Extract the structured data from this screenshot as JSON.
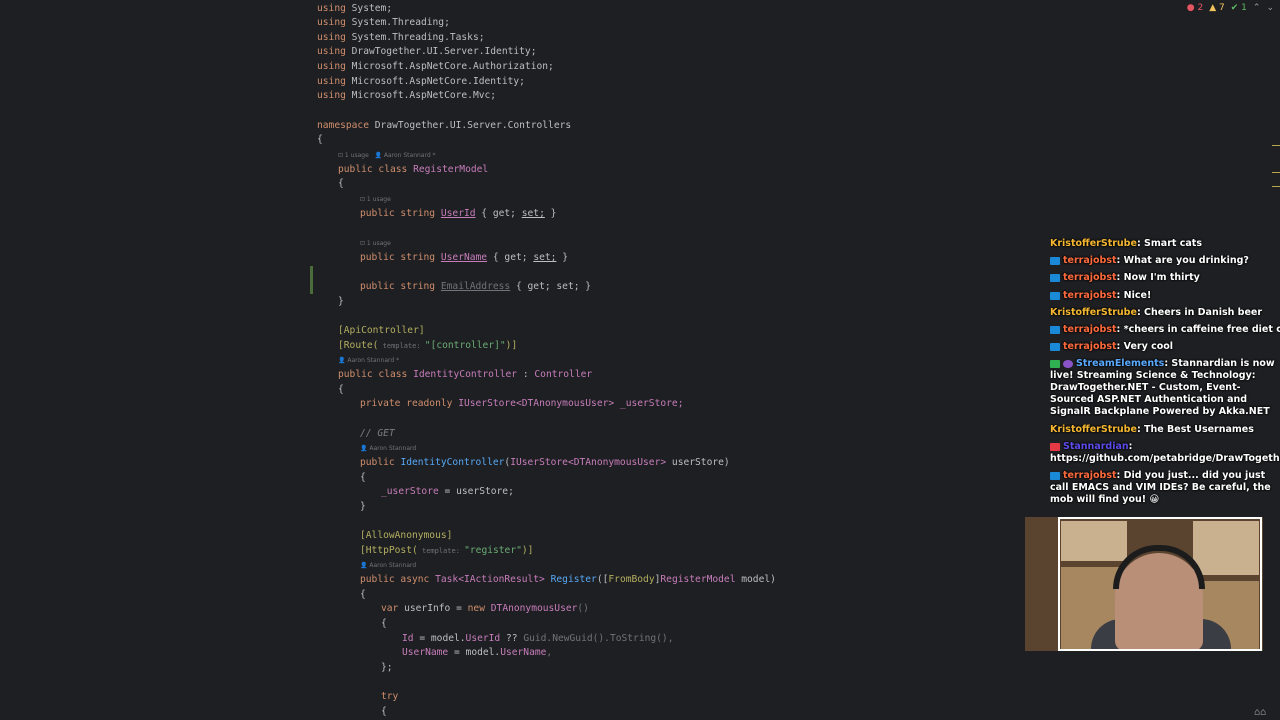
{
  "status": {
    "errors": "2",
    "warnings": "7",
    "ok": "1"
  },
  "code": {
    "l1": [
      "using ",
      "System",
      ";"
    ],
    "l2": [
      "using ",
      "System.Threading",
      ";"
    ],
    "l3": [
      "using ",
      "System.Threading.Tasks",
      ";"
    ],
    "l4": [
      "using ",
      "DrawTogether.UI.Server.Identity",
      ";"
    ],
    "l5": [
      "using ",
      "Microsoft.AspNetCore.Authorization",
      ";"
    ],
    "l6": [
      "using ",
      "Microsoft.AspNetCore.Identity",
      ";"
    ],
    "l7": [
      "using ",
      "Microsoft.AspNetCore.Mvc",
      ";"
    ],
    "ns_kw": "namespace ",
    "ns_name": "DrawTogether.UI.Server.Controllers",
    "brace_open": "{",
    "brace_close": "}",
    "hint_class": "⊡ 1 usage   👤 Aaron Stannard *",
    "class_kw": "public class ",
    "class_name": "RegisterModel",
    "hint_usage": "⊡ 1 usage",
    "prop_kw": "public string ",
    "prop_userid": "UserId",
    "prop_username": "UserName",
    "prop_email": "EmailAddress",
    "getset_open": " { get; ",
    "set_kw": "set;",
    "getset_close": " }",
    "getset_full": " { get; set; }",
    "attr_api": "[ApiController]",
    "attr_route_a": "[Route(",
    "attr_route_param": " template: ",
    "attr_route_str": "\"[controller]\"",
    "attr_route_b": ")]",
    "hint_author": "👤 Aaron Stannard *",
    "ctrl_kw": "public class ",
    "ctrl_name": "IdentityController",
    "ctrl_sep": " : ",
    "ctrl_base": "Controller",
    "field_kw": "private readonly ",
    "field_type": "IUserStore<DTAnonymousUser>",
    "field_name": " _userStore;",
    "comment_get": "// GET",
    "hint_author2": "👤 Aaron Stannard",
    "ctor_kw": "public ",
    "ctor_name": "IdentityController",
    "ctor_args_a": "(",
    "ctor_args_type": "IUserStore<DTAnonymousUser>",
    "ctor_args_b": " userStore)",
    "assign": "_userStore",
    "assign_b": " = userStore;",
    "attr_allow": "[AllowAnonymous]",
    "attr_post_a": "[HttpPost(",
    "attr_post_param": " template: ",
    "attr_post_str": "\"register\"",
    "attr_post_b": ")]",
    "reg_kw": "public async ",
    "reg_type": "Task<IActionResult>",
    "reg_name": " Register",
    "reg_a": "([",
    "reg_attr": "FromBody",
    "reg_b": "]",
    "reg_type2": "RegisterModel",
    "reg_c": " model)",
    "var_kw": "var ",
    "var_name": "userInfo = ",
    "new_kw": "new ",
    "new_type": "DTAnonymousUser",
    "new_paren": "()",
    "id_a": "Id",
    "id_b": " = model.",
    "id_c": "UserId",
    "id_d": " ?? ",
    "id_e": "Guid.NewGuid().ToString(),",
    "un_a": "UserName",
    "un_b": " = model.",
    "un_c": "UserName",
    "un_d": ",",
    "close_semi": "};",
    "try_kw": "try"
  },
  "chat": [
    {
      "user": "KristofferStrube",
      "text": "Smart cats",
      "user_color": "#f5b731",
      "badge": ""
    },
    {
      "user": "terrajobst",
      "text": "What are you drinking?",
      "user_color": "#ff6a3d",
      "badge": "blue"
    },
    {
      "user": "terrajobst",
      "text": "Now I'm thirty",
      "user_color": "#ff6a3d",
      "badge": "blue"
    },
    {
      "user": "terrajobst",
      "text": "Nice!",
      "user_color": "#ff6a3d",
      "badge": "blue"
    },
    {
      "user": "KristofferStrube",
      "text": "Cheers in Danish beer",
      "user_color": "#f5b731",
      "badge": ""
    },
    {
      "user": "terrajobst",
      "text": "*cheers in caffeine free diet coke*",
      "user_color": "#ff6a3d",
      "badge": "blue"
    },
    {
      "user": "terrajobst",
      "text": "Very cool",
      "user_color": "#ff6a3d",
      "badge": "blue"
    },
    {
      "user": "StreamElements",
      "text": "Stannardian is now live! Streaming Science & Technology: DrawTogether.NET - Custom, Event-Sourced ASP.NET Authentication and SignalR Backplane Powered by Akka.NET",
      "user_color": "#5aa9ff",
      "badge": "green"
    },
    {
      "user": "KristofferStrube",
      "text": "The Best Usernames",
      "user_color": "#f5b731",
      "badge": ""
    },
    {
      "user": "Stannardian",
      "text": "https://github.com/petabridge/DrawTogether.NET",
      "user_color": "#5b4be8",
      "badge": "red"
    },
    {
      "user": "terrajobst",
      "text": "Did you just... did you just call EMACS and VIM IDEs? Be careful, the mob will find you! 😀",
      "user_color": "#ff6a3d",
      "badge": "blue"
    }
  ]
}
